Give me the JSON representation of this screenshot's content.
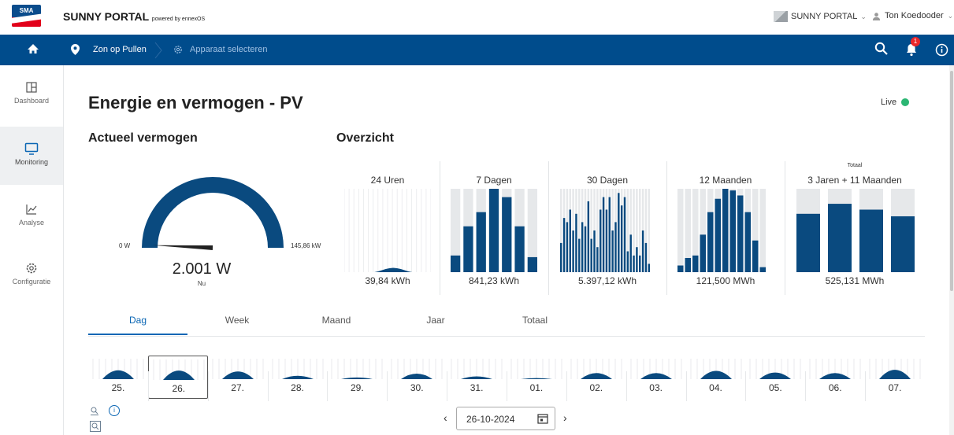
{
  "topbar": {
    "brand": "SUNNY PORTAL",
    "brand_sub": "powered by ennexOS",
    "logo_text": "SMA",
    "portal_select": "SUNNY PORTAL",
    "user_name": "Ton Koedooder"
  },
  "navbar": {
    "plant": "Zon op Pullen",
    "device_select": "Apparaat selecteren",
    "notification_count": "1"
  },
  "sidebar": {
    "items": [
      {
        "label": "Dashboard",
        "icon": "dashboard-icon"
      },
      {
        "label": "Monitoring",
        "icon": "monitor-icon",
        "active": true
      },
      {
        "label": "Analyse",
        "icon": "chart-icon"
      },
      {
        "label": "Configuratie",
        "icon": "gear-icon"
      }
    ]
  },
  "page": {
    "title": "Energie en vermogen - PV",
    "live_label": "Live"
  },
  "current_power": {
    "heading": "Actueel vermogen",
    "min_label": "0 W",
    "max_label": "145,86 kW",
    "value": "2.001 W",
    "sub": "Nu",
    "fraction": 0.0137
  },
  "overview": {
    "heading": "Overzicht",
    "cards": [
      {
        "title": "24 Uren",
        "value": "39,84 kWh"
      },
      {
        "title": "7 Dagen",
        "value": "841,23 kWh"
      },
      {
        "title": "30 Dagen",
        "value": "5.397,12 kWh"
      },
      {
        "title": "12 Maanden",
        "value": "121,500 MWh"
      },
      {
        "title": "3 Jaren + 11 Maanden",
        "value": "525,131 MWh",
        "top_label": "Totaal"
      }
    ]
  },
  "chart_data": [
    {
      "type": "area",
      "title": "24 Uren",
      "values": [
        0,
        0,
        0,
        0,
        0,
        0,
        0,
        0,
        0,
        0.2,
        0.5,
        0.8,
        1.0,
        1.1,
        1.0,
        0.8,
        0.5,
        0.2,
        0,
        0,
        0,
        0,
        0,
        0
      ]
    },
    {
      "type": "bar",
      "title": "7 Dagen",
      "values": [
        0.2,
        0.55,
        0.72,
        1.0,
        0.9,
        0.55,
        0.18
      ]
    },
    {
      "type": "bar",
      "title": "30 Dagen",
      "values": [
        0.35,
        0.65,
        0.6,
        0.75,
        0.5,
        0.7,
        0.4,
        0.6,
        0.55,
        0.85,
        0.4,
        0.5,
        0.3,
        0.75,
        0.9,
        0.75,
        0.9,
        0.5,
        0.6,
        0.95,
        0.8,
        0.9,
        0.25,
        0.45,
        0.2,
        0.3,
        0.2,
        0.5,
        0.35,
        0.1
      ]
    },
    {
      "type": "bar",
      "title": "12 Maanden",
      "values": [
        0.08,
        0.17,
        0.2,
        0.45,
        0.72,
        0.88,
        1.0,
        0.98,
        0.92,
        0.72,
        0.38,
        0.06
      ]
    },
    {
      "type": "bar",
      "title": "Totaal",
      "values": [
        0.7,
        0.82,
        0.75,
        0.67
      ]
    }
  ],
  "tabs": [
    "Dag",
    "Week",
    "Maand",
    "Jaar",
    "Totaal"
  ],
  "days": [
    "25.",
    "26.",
    "27.",
    "28.",
    "29.",
    "30.",
    "31.",
    "01.",
    "02.",
    "03.",
    "04.",
    "05.",
    "06.",
    "07."
  ],
  "day_peaks": [
    0.8,
    0.85,
    0.7,
    0.3,
    0.15,
    0.5,
    0.25,
    0.1,
    0.55,
    0.55,
    0.75,
    0.6,
    0.55,
    0.85
  ],
  "date_picker": {
    "value": "26-10-2024"
  }
}
